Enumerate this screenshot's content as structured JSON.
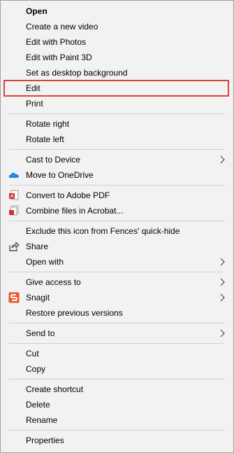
{
  "menu": {
    "items": [
      {
        "label": "Open"
      },
      {
        "label": "Create a new video"
      },
      {
        "label": "Edit with Photos"
      },
      {
        "label": "Edit with Paint 3D"
      },
      {
        "label": "Set as desktop background"
      },
      {
        "label": "Edit"
      },
      {
        "label": "Print"
      },
      {
        "label": "Rotate right"
      },
      {
        "label": "Rotate left"
      },
      {
        "label": "Cast to Device"
      },
      {
        "label": "Move to OneDrive",
        "icon": "onedrive-cloud-icon"
      },
      {
        "label": "Convert to Adobe PDF",
        "icon": "adobe-pdf-icon"
      },
      {
        "label": "Combine files in Acrobat...",
        "icon": "acrobat-combine-icon"
      },
      {
        "label": "Exclude this icon from Fences' quick-hide"
      },
      {
        "label": "Share",
        "icon": "share-icon"
      },
      {
        "label": "Open with"
      },
      {
        "label": "Give access to"
      },
      {
        "label": "Snagit",
        "icon": "snagit-icon"
      },
      {
        "label": "Restore previous versions"
      },
      {
        "label": "Send to"
      },
      {
        "label": "Cut"
      },
      {
        "label": "Copy"
      },
      {
        "label": "Create shortcut"
      },
      {
        "label": "Delete"
      },
      {
        "label": "Rename"
      },
      {
        "label": "Properties"
      }
    ]
  },
  "colors": {
    "highlight_border": "#e0403a",
    "menu_background": "#f2f2f2",
    "separator": "#d0d0d0"
  }
}
